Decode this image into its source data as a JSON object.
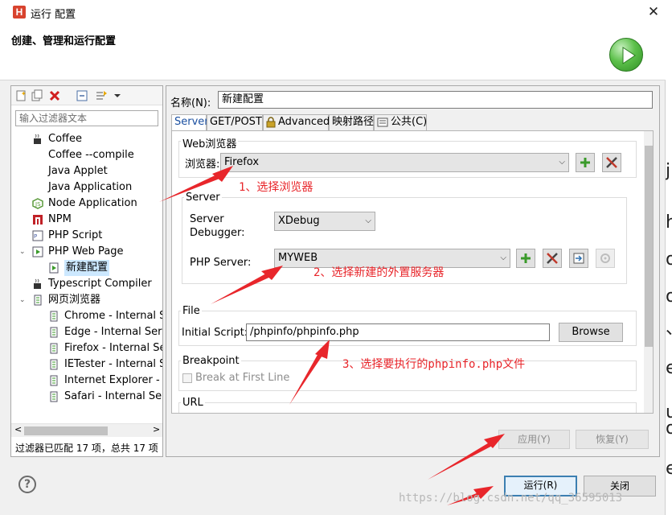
{
  "window": {
    "title": "运行 配置",
    "app_icon": "H",
    "close_label": "✕"
  },
  "header": {
    "title": "创建、管理和运行配置"
  },
  "left": {
    "filter_placeholder": "输入过滤器文本",
    "tree": [
      {
        "label": "Coffee",
        "icon": "coffee-icon",
        "level": 0,
        "expander": ""
      },
      {
        "label": "Coffee --compile",
        "icon": "",
        "level": 0,
        "expander": ""
      },
      {
        "label": "Java Applet",
        "icon": "",
        "level": 0,
        "expander": ""
      },
      {
        "label": "Java Application",
        "icon": "",
        "level": 0,
        "expander": ""
      },
      {
        "label": "Node Application",
        "icon": "node-icon",
        "level": 0,
        "expander": ""
      },
      {
        "label": "NPM",
        "icon": "npm-icon",
        "level": 0,
        "expander": ""
      },
      {
        "label": "PHP Script",
        "icon": "php-script-icon",
        "level": 0,
        "expander": ""
      },
      {
        "label": "PHP Web Page",
        "icon": "php-web-icon",
        "level": 0,
        "expander": "⌄"
      },
      {
        "label": "新建配置",
        "icon": "run-config-icon",
        "level": 1,
        "expander": "",
        "selected": true
      },
      {
        "label": "Typescript Compiler",
        "icon": "typescript-icon",
        "level": 0,
        "expander": ""
      },
      {
        "label": "网页浏览器",
        "icon": "browser-group-icon",
        "level": 0,
        "expander": "⌄"
      },
      {
        "label": "Chrome - Internal Se",
        "icon": "browser-item-icon",
        "level": 1,
        "expander": ""
      },
      {
        "label": "Edge - Internal Serv",
        "icon": "browser-item-icon",
        "level": 1,
        "expander": ""
      },
      {
        "label": "Firefox - Internal Ser",
        "icon": "browser-item-icon",
        "level": 1,
        "expander": ""
      },
      {
        "label": "IETester - Internal S",
        "icon": "browser-item-icon",
        "level": 1,
        "expander": ""
      },
      {
        "label": "Internet Explorer - I",
        "icon": "browser-item-icon",
        "level": 1,
        "expander": ""
      },
      {
        "label": "Safari - Internal Serv",
        "icon": "browser-item-icon",
        "level": 1,
        "expander": ""
      }
    ],
    "scroll_left": "<",
    "scroll_right": ">",
    "status": "过滤器已匹配 17 项，总共 17 项"
  },
  "right": {
    "name_label": "名称(N):",
    "name_value": "新建配置",
    "tabs": [
      "Server",
      "GET/POST",
      "Advanced",
      "映射路径",
      "公共(C)"
    ],
    "web_browser": {
      "group": "Web浏览器",
      "label": "浏览器:",
      "value": "Firefox"
    },
    "server": {
      "group": "Server",
      "debugger_label_1": "Server",
      "debugger_label_2": "Debugger:",
      "debugger_value": "XDebug",
      "php_server_label": "PHP Server:",
      "php_server_value": "MYWEB"
    },
    "file": {
      "group": "File",
      "label": "Initial Script:",
      "value": "/phpinfo/phpinfo.php",
      "browse": "Browse"
    },
    "breakpoint": {
      "group": "Breakpoint",
      "checkbox_label": "Break at First Line"
    },
    "url": {
      "group": "URL"
    },
    "apply": "应用(Y)",
    "revert": "恢复(Y)"
  },
  "footer": {
    "run": "运行(R)",
    "close": "关闭",
    "help": "?"
  },
  "annotations": {
    "step1": "1、选择浏览器",
    "step2": "2、选择新建的外置服务器",
    "step3": "3、选择要执行的phpinfo.php文件",
    "color": "#e8262b"
  },
  "background": {
    "watermark": "https://blog.csdn.net/qq_36595013",
    "chars": [
      "j",
      "h",
      "o",
      "o",
      "、",
      "e",
      "u",
      "o",
      "e"
    ]
  }
}
